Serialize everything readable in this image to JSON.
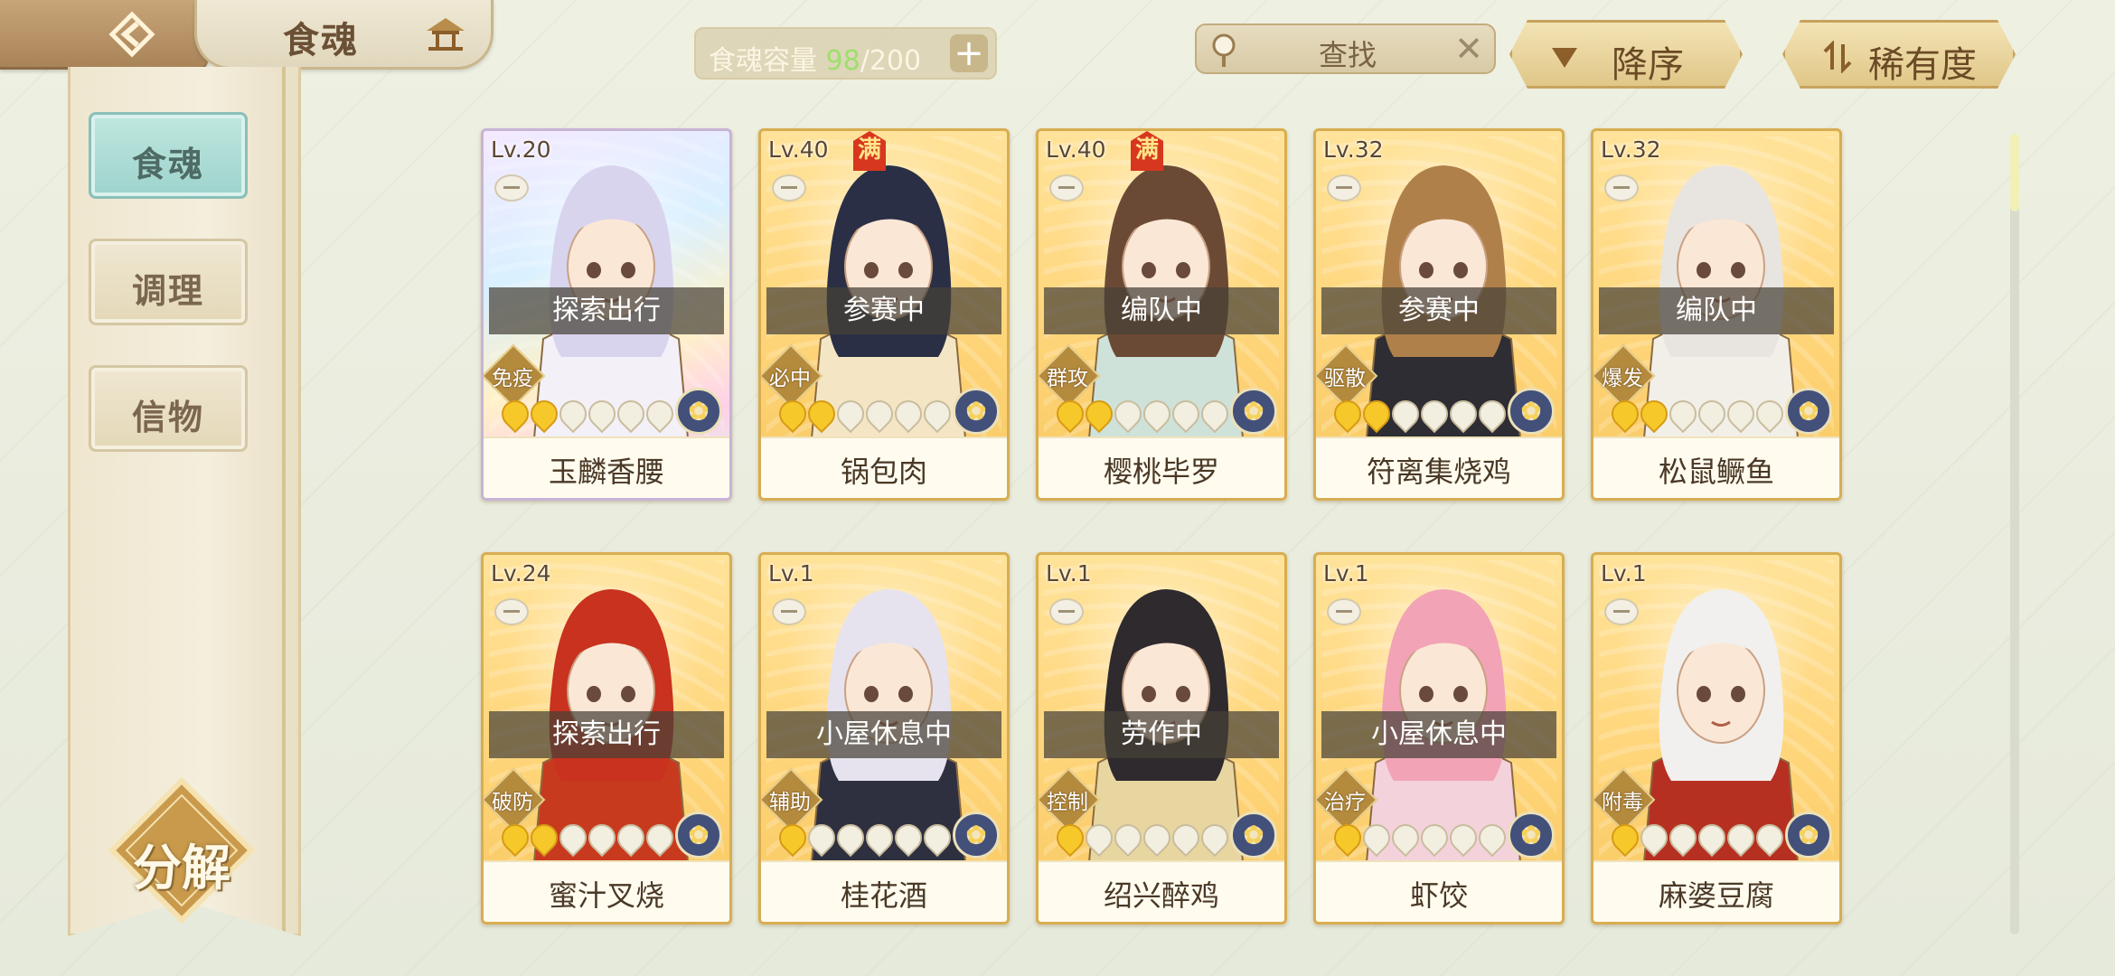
{
  "header": {
    "title": "食魂"
  },
  "capacity": {
    "label": "食魂容量",
    "current": "98",
    "separator": "/",
    "max": "200",
    "add": "+"
  },
  "search": {
    "placeholder": "查找",
    "clear": "✕"
  },
  "sort": {
    "order_label": "降序",
    "criteria_label": "稀有度"
  },
  "sidebar": {
    "items": [
      {
        "label": "食魂",
        "active": true
      },
      {
        "label": "调理",
        "active": false
      },
      {
        "label": "信物",
        "active": false
      }
    ],
    "decompose_label": "分解"
  },
  "colors": {
    "accent_teal": "#9dd3cc",
    "card_gold": "#ffd57a",
    "star_on": "#f7c829",
    "max_badge": "#d7371e"
  },
  "cards": [
    {
      "level": "Lv.20",
      "status": "探索出行",
      "role": "免疫",
      "name": "玉麟香腰",
      "stars_on": 2,
      "max": "",
      "rarity": "rainbow"
    },
    {
      "level": "Lv.40",
      "status": "参赛中",
      "role": "必中",
      "name": "锅包肉",
      "stars_on": 2,
      "max": "满",
      "rarity": "gold"
    },
    {
      "level": "Lv.40",
      "status": "编队中",
      "role": "群攻",
      "name": "樱桃毕罗",
      "stars_on": 2,
      "max": "满",
      "rarity": "gold"
    },
    {
      "level": "Lv.32",
      "status": "参赛中",
      "role": "驱散",
      "name": "符离集烧鸡",
      "stars_on": 2,
      "max": "",
      "rarity": "gold"
    },
    {
      "level": "Lv.32",
      "status": "编队中",
      "role": "爆发",
      "name": "松鼠鳜鱼",
      "stars_on": 2,
      "max": "",
      "rarity": "gold"
    },
    {
      "level": "Lv.24",
      "status": "探索出行",
      "role": "破防",
      "name": "蜜汁叉烧",
      "stars_on": 2,
      "max": "",
      "rarity": "gold"
    },
    {
      "level": "Lv.1",
      "status": "小屋休息中",
      "role": "辅助",
      "name": "桂花酒",
      "stars_on": 1,
      "max": "",
      "rarity": "gold"
    },
    {
      "level": "Lv.1",
      "status": "劳作中",
      "role": "控制",
      "name": "绍兴醉鸡",
      "stars_on": 1,
      "max": "",
      "rarity": "gold"
    },
    {
      "level": "Lv.1",
      "status": "小屋休息中",
      "role": "治疗",
      "name": "虾饺",
      "stars_on": 1,
      "max": "",
      "rarity": "gold"
    },
    {
      "level": "Lv.1",
      "status": "",
      "role": "附毒",
      "name": "麻婆豆腐",
      "stars_on": 1,
      "max": "",
      "rarity": "gold"
    }
  ]
}
